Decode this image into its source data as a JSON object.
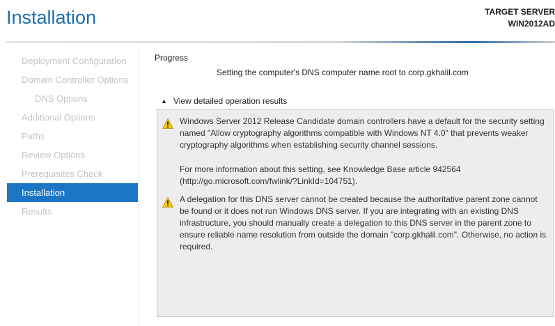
{
  "header": {
    "title": "Installation",
    "target_server_label": "TARGET SERVER",
    "target_server_name": "WIN2012AD"
  },
  "sidebar": {
    "items": [
      {
        "label": "Deployment Configuration",
        "state": "disabled"
      },
      {
        "label": "Domain Controller Options",
        "state": "disabled"
      },
      {
        "label": "DNS Options",
        "state": "disabled"
      },
      {
        "label": "Additional Options",
        "state": "disabled"
      },
      {
        "label": "Paths",
        "state": "disabled"
      },
      {
        "label": "Review Options",
        "state": "disabled"
      },
      {
        "label": "Prerequisites Check",
        "state": "disabled"
      },
      {
        "label": "Installation",
        "state": "active"
      },
      {
        "label": "Results",
        "state": "disabled"
      }
    ]
  },
  "main": {
    "progress_label": "Progress",
    "status_text": "Setting the computer's DNS computer name root to corp.gkhalil.com",
    "details_toggle_label": "View detailed operation results",
    "messages": [
      {
        "icon": "warning-icon",
        "text": "Windows Server 2012 Release Candidate domain controllers have a default for the security setting named \"Allow cryptography algorithms compatible with Windows NT 4.0\" that prevents weaker cryptography algorithms when establishing security channel sessions."
      },
      {
        "icon": "none",
        "text": "For more information about this setting, see Knowledge Base article 942564 (http://go.microsoft.com/fwlink/?LinkId=104751)."
      },
      {
        "icon": "warning-icon",
        "text": "A delegation for this DNS server cannot be created because the authoritative parent zone cannot be found or it does not run Windows DNS server. If you are integrating with an existing DNS infrastructure, you should manually create a delegation to this DNS server in the parent zone to ensure reliable name resolution from outside the domain \"corp.gkhalil.com\". Otherwise, no action is required."
      }
    ]
  },
  "colors": {
    "accent": "#1a76c5",
    "title": "#1d6fb0",
    "warning": "#f2c811"
  }
}
